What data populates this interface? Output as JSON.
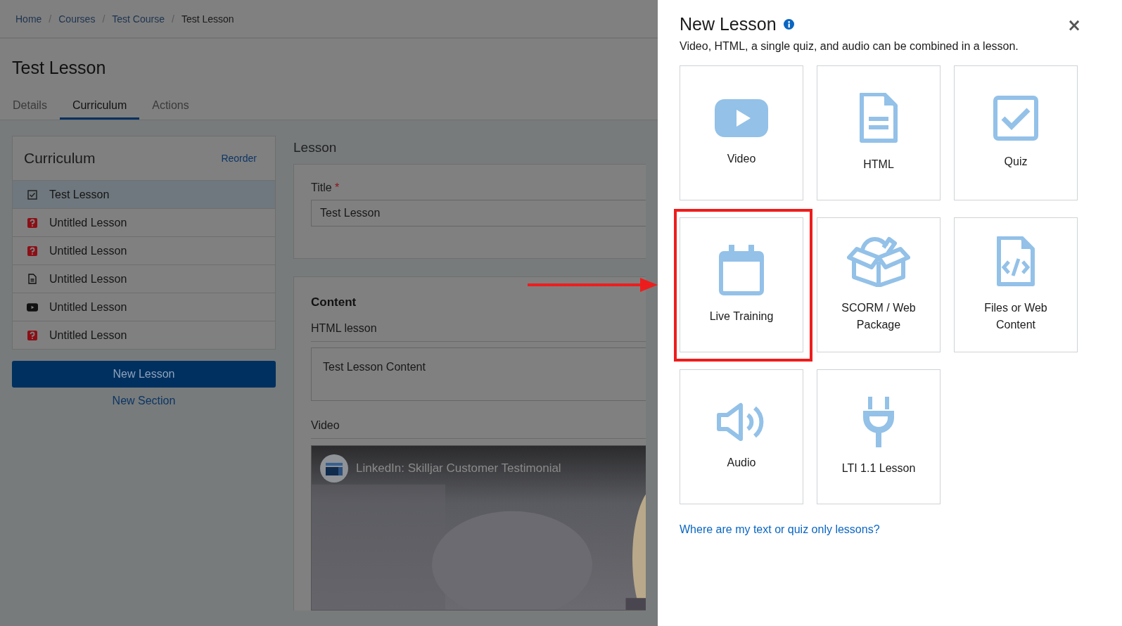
{
  "breadcrumb": [
    {
      "label": "Home",
      "current": false
    },
    {
      "label": "Courses",
      "current": false
    },
    {
      "label": "Test Course",
      "current": false
    },
    {
      "label": "Test Lesson",
      "current": true
    }
  ],
  "breadcrumb_separator": "/",
  "page_title": "Test Lesson",
  "tabs": [
    {
      "label": "Details",
      "selected": false
    },
    {
      "label": "Curriculum",
      "selected": true
    },
    {
      "label": "Actions",
      "selected": false
    }
  ],
  "curriculum": {
    "title": "Curriculum",
    "reorder": "Reorder",
    "items": [
      {
        "label": "Test Lesson",
        "kind": "checkbox",
        "selected": true
      },
      {
        "label": "Untitled Lesson",
        "kind": "quiz",
        "selected": false
      },
      {
        "label": "Untitled Lesson",
        "kind": "quiz",
        "selected": false
      },
      {
        "label": "Untitled Lesson",
        "kind": "html",
        "selected": false
      },
      {
        "label": "Untitled Lesson",
        "kind": "video",
        "selected": false
      },
      {
        "label": "Untitled Lesson",
        "kind": "quiz",
        "selected": false
      }
    ],
    "new_lesson": "New Lesson",
    "new_section": "New Section"
  },
  "lesson": {
    "heading": "Lesson",
    "title_label": "Title",
    "required_mark": "*",
    "title_value": "Test Lesson"
  },
  "content": {
    "heading": "Content",
    "html_label": "HTML lesson",
    "html_value": "Test Lesson Content",
    "video_label": "Video",
    "video_title": "LinkedIn: Skilljar Customer Testimonial"
  },
  "panel": {
    "title": "New Lesson",
    "close": "×",
    "subtitle": "Video, HTML, a single quiz, and audio can be combined in a lesson.",
    "tiles": [
      {
        "label": "Video",
        "kind": "video",
        "highlighted": false
      },
      {
        "label": "HTML",
        "kind": "html",
        "highlighted": false
      },
      {
        "label": "Quiz",
        "kind": "quiz",
        "highlighted": false
      },
      {
        "label": "Live Training",
        "kind": "calendar",
        "highlighted": true
      },
      {
        "label": "SCORM / Web Package",
        "kind": "package",
        "highlighted": false
      },
      {
        "label": "Files or Web Content",
        "kind": "code",
        "highlighted": false
      },
      {
        "label": "Audio",
        "kind": "audio",
        "highlighted": false
      },
      {
        "label": "LTI 1.1 Lesson",
        "kind": "plug",
        "highlighted": false
      }
    ],
    "help_link": "Where are my text or quiz only lessons?"
  }
}
